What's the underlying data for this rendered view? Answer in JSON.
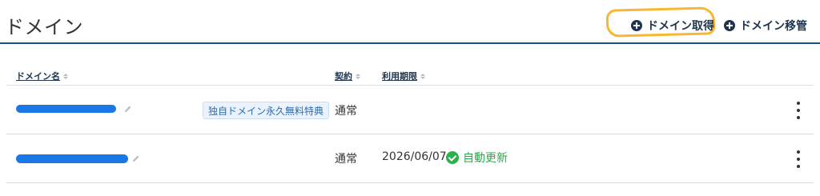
{
  "page": {
    "title": "ドメイン",
    "actions": [
      {
        "label": "ドメイン取得",
        "icon": "plus-circle-icon"
      },
      {
        "label": "ドメイン移管",
        "icon": "plus-circle-icon"
      }
    ]
  },
  "table": {
    "columns": [
      {
        "label": "ドメイン名",
        "sortable": true
      },
      {
        "label": "契約",
        "sortable": true
      },
      {
        "label": "利用期限",
        "sortable": true
      }
    ],
    "rows": [
      {
        "badge": "独自ドメイン永久無料特典",
        "contract": "通常",
        "expiry": "",
        "renew": ""
      },
      {
        "badge": "",
        "contract": "通常",
        "expiry": "2026/06/07",
        "renew": "自動更新"
      }
    ]
  },
  "colors": {
    "primary": "#1e3550",
    "accent_rule": "#1e4f86",
    "highlight": "#f7b731",
    "renew_green": "#2aa84a",
    "badge_text": "#2b6cb0"
  }
}
